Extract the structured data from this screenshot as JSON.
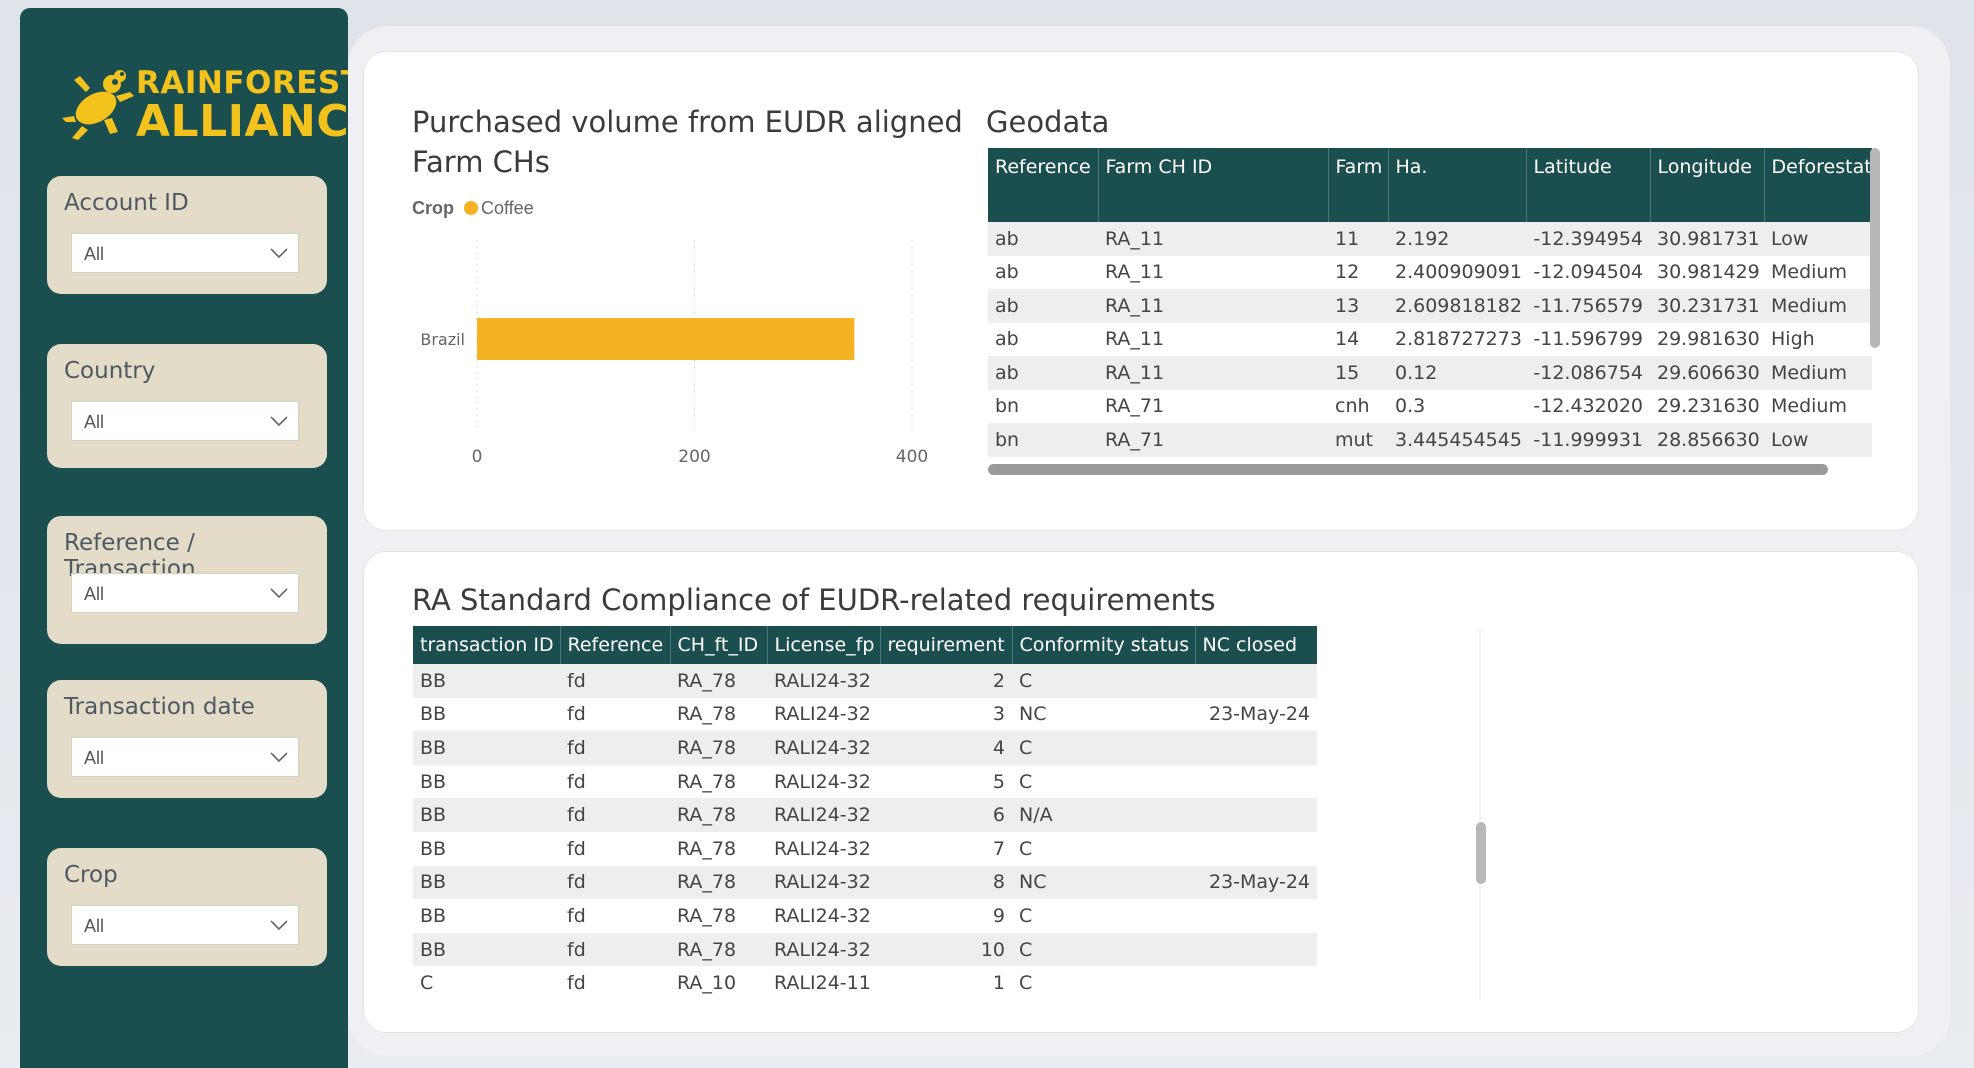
{
  "brand": {
    "line1": "RAINFOREST",
    "line2": "ALLIANCE"
  },
  "filters": [
    {
      "label": "Account ID",
      "value": "All"
    },
    {
      "label": "Country",
      "value": "All"
    },
    {
      "label": "Reference / Transaction",
      "value": "All"
    },
    {
      "label": "Transaction date",
      "value": "All"
    },
    {
      "label": "Crop",
      "value": "All"
    }
  ],
  "volume_card": {
    "title_line1": "Purchased volume from EUDR aligned",
    "title_line2": "Farm CHs",
    "legend_title": "Crop",
    "legend_item": "Coffee"
  },
  "chart_data": {
    "type": "bar",
    "orientation": "horizontal",
    "categories": [
      "Brazil"
    ],
    "series": [
      {
        "name": "Coffee",
        "values": [
          347
        ],
        "color": "#f5b223"
      }
    ],
    "xlim": [
      0,
      400
    ],
    "x_ticks": [
      "0",
      "200",
      "400"
    ],
    "grid": true
  },
  "geodata": {
    "title": "Geodata",
    "columns": [
      "Reference",
      "Farm CH ID",
      "Farm",
      "Ha.",
      "Latitude",
      "Longitude",
      "Deforestation risk"
    ],
    "rows": [
      [
        "ab",
        "RA_11",
        "11",
        "2.192",
        "-12.394954",
        "30.981731",
        "Low"
      ],
      [
        "ab",
        "RA_11",
        "12",
        "2.400909091",
        "-12.094504",
        "30.981429",
        "Medium"
      ],
      [
        "ab",
        "RA_11",
        "13",
        "2.609818182",
        "-11.756579",
        "30.231731",
        "Medium"
      ],
      [
        "ab",
        "RA_11",
        "14",
        "2.818727273",
        "-11.596799",
        "29.981630",
        "High"
      ],
      [
        "ab",
        "RA_11",
        "15",
        "0.12",
        "-12.086754",
        "29.606630",
        "Medium"
      ],
      [
        "bn",
        "RA_71",
        "cnh",
        "0.3",
        "-12.432020",
        "29.231630",
        "Medium"
      ],
      [
        "bn",
        "RA_71",
        "mut",
        "3.445454545",
        "-11.999931",
        "28.856630",
        "Low"
      ]
    ]
  },
  "compliance": {
    "title": "RA Standard Compliance of EUDR-related requirements",
    "columns": [
      "transaction ID",
      "Reference",
      "CH_ft_ID",
      "License_fp",
      "requirement",
      "Conformity status",
      "NC closed"
    ],
    "rows": [
      [
        "BB",
        "fd",
        "RA_78",
        "RALI24-32",
        "2",
        "C",
        ""
      ],
      [
        "BB",
        "fd",
        "RA_78",
        "RALI24-32",
        "3",
        "NC",
        "23-May-24"
      ],
      [
        "BB",
        "fd",
        "RA_78",
        "RALI24-32",
        "4",
        "C",
        ""
      ],
      [
        "BB",
        "fd",
        "RA_78",
        "RALI24-32",
        "5",
        "C",
        ""
      ],
      [
        "BB",
        "fd",
        "RA_78",
        "RALI24-32",
        "6",
        "N/A",
        ""
      ],
      [
        "BB",
        "fd",
        "RA_78",
        "RALI24-32",
        "7",
        "C",
        ""
      ],
      [
        "BB",
        "fd",
        "RA_78",
        "RALI24-32",
        "8",
        "NC",
        "23-May-24"
      ],
      [
        "BB",
        "fd",
        "RA_78",
        "RALI24-32",
        "9",
        "C",
        ""
      ],
      [
        "BB",
        "fd",
        "RA_78",
        "RALI24-32",
        "10",
        "C",
        ""
      ],
      [
        "C",
        "fd",
        "RA_10",
        "RALI24-11",
        "1",
        "C",
        ""
      ]
    ]
  }
}
